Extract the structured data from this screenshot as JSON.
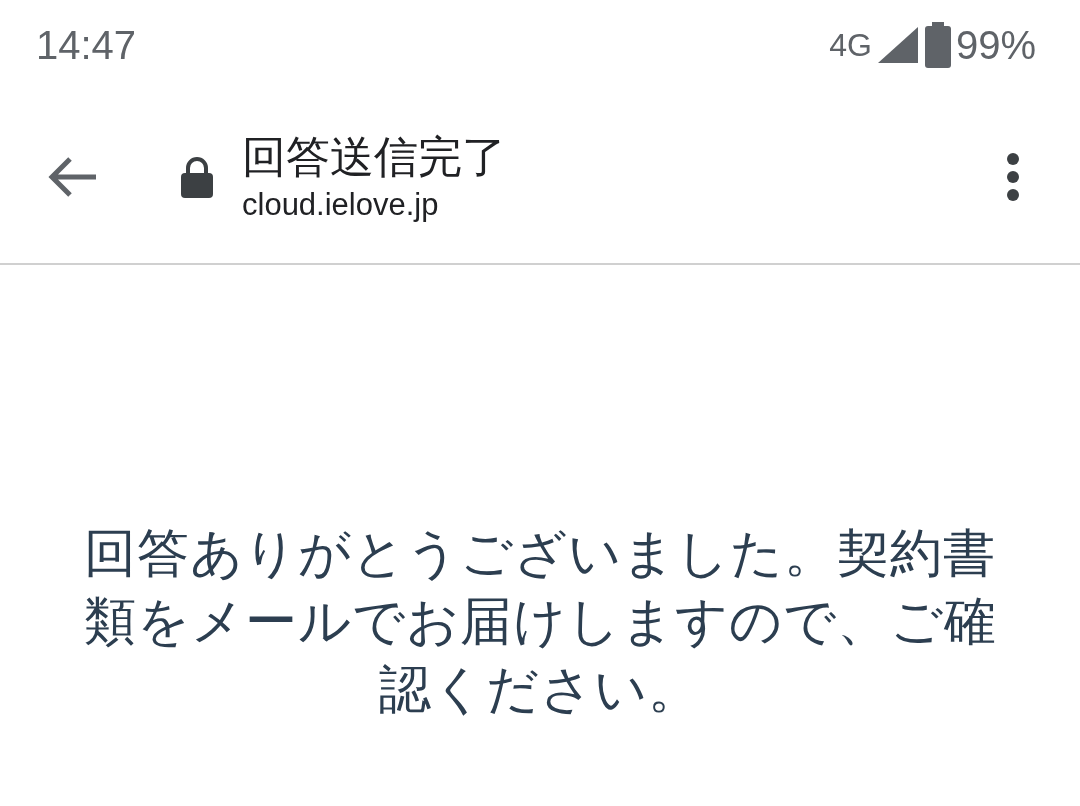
{
  "status_bar": {
    "time": "14:47",
    "network": "4G",
    "battery": "99%"
  },
  "toolbar": {
    "title": "回答送信完了",
    "url": "cloud.ielove.jp"
  },
  "message": "回答ありがとうございました。契約書類をメールでお届けしますので、ご確認ください。"
}
